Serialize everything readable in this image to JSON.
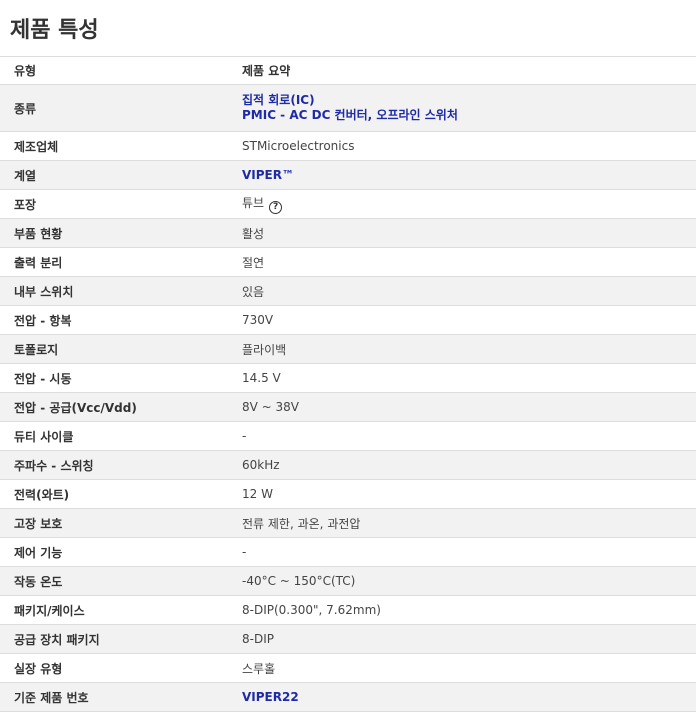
{
  "page": {
    "title": "제품 특성"
  },
  "header": {
    "type_label": "유형",
    "summary_label": "제품 요약"
  },
  "rows": [
    {
      "attr": "종류",
      "links": [
        "집적 회로(IC)",
        "PMIC - AC DC 컨버터, 오프라인 스위처"
      ]
    },
    {
      "attr": "제조업체",
      "value": "STMicroelectronics"
    },
    {
      "attr": "계열",
      "link": "VIPER™"
    },
    {
      "attr": "포장",
      "value": "튜브",
      "icon": "help-circle-icon"
    },
    {
      "attr": "부품 현황",
      "value": "활성"
    },
    {
      "attr": "출력 분리",
      "value": "절연"
    },
    {
      "attr": "내부 스위치",
      "value": "있음"
    },
    {
      "attr": "전압 - 항복",
      "value": "730V"
    },
    {
      "attr": "토폴로지",
      "value": "플라이백"
    },
    {
      "attr": "전압 - 시동",
      "value": "14.5 V"
    },
    {
      "attr": "전압 - 공급(Vcc/Vdd)",
      "value": "8V ~ 38V"
    },
    {
      "attr": "듀티 사이클",
      "value": "-"
    },
    {
      "attr": "주파수 - 스위칭",
      "value": "60kHz"
    },
    {
      "attr": "전력(와트)",
      "value": "12 W"
    },
    {
      "attr": "고장 보호",
      "value": "전류 제한, 과온, 과전압"
    },
    {
      "attr": "제어 기능",
      "value": "-"
    },
    {
      "attr": "작동 온도",
      "value": "-40°C ~ 150°C(TC)"
    },
    {
      "attr": "패키지/케이스",
      "value": "8-DIP(0.300\", 7.62mm)"
    },
    {
      "attr": "공급 장치 패키지",
      "value": "8-DIP"
    },
    {
      "attr": "실장 유형",
      "value": "스루홀"
    },
    {
      "attr": "기준 제품 번호",
      "link": "VIPER22"
    }
  ]
}
